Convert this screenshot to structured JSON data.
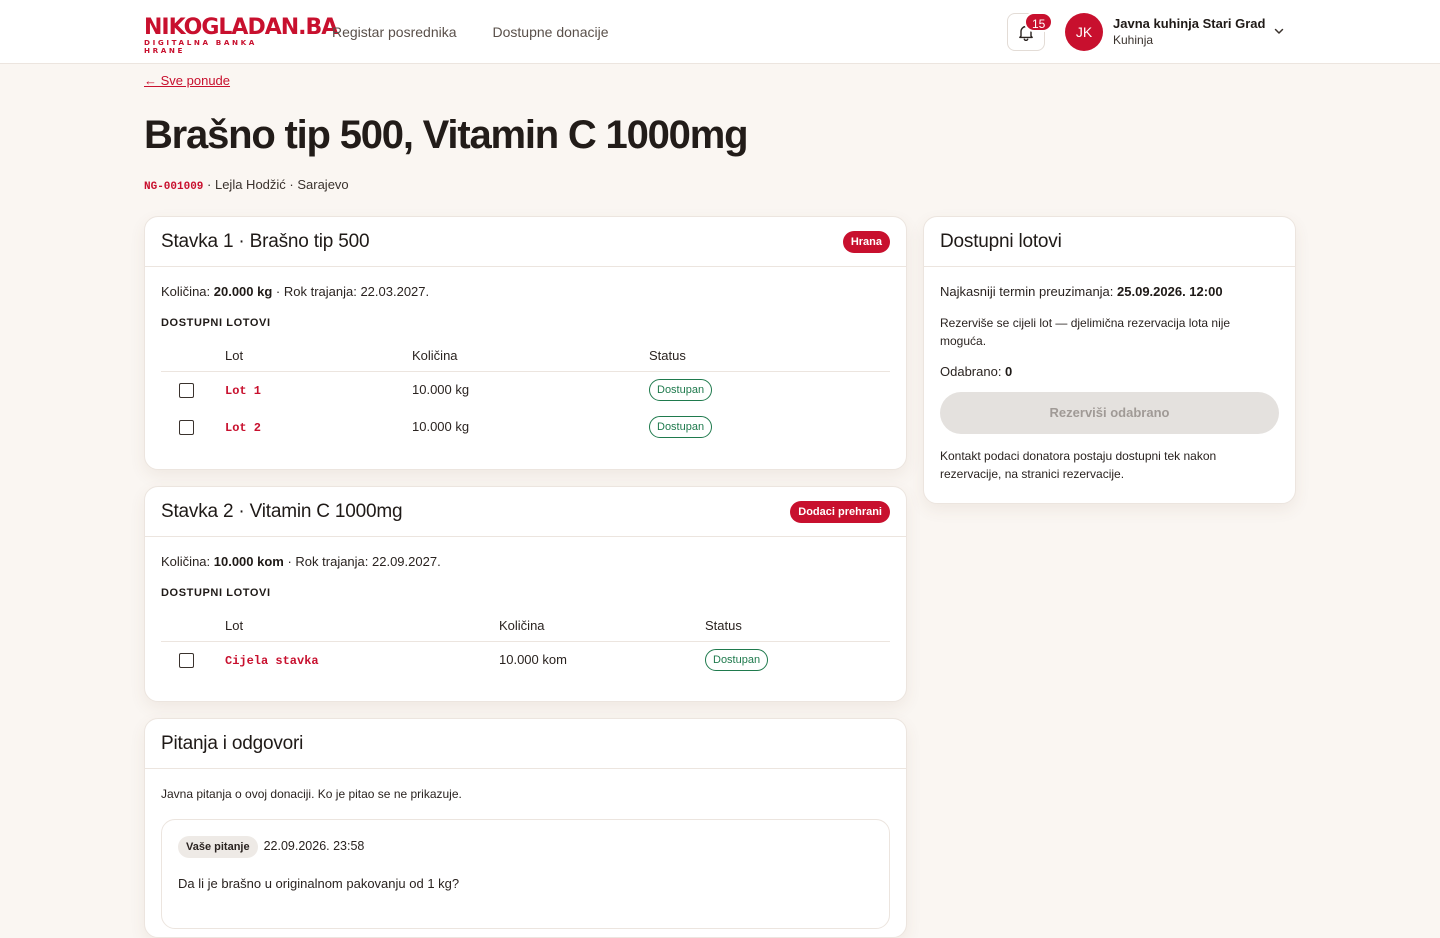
{
  "brand": {
    "name": "NIKOGLADAN.BA",
    "tagline": "DIGITALNA BANKA HRANE"
  },
  "nav": [
    {
      "label": "Registar posrednika"
    },
    {
      "label": "Dostupne donacije"
    }
  ],
  "notifications": {
    "count": "15"
  },
  "user": {
    "initials": "JK",
    "name": "Javna kuhinja Stari Grad",
    "role": "Kuhinja"
  },
  "page": {
    "back_label": "← Sve ponude",
    "title": "Brašno tip 500, Vitamin C 1000mg",
    "code": "NG-001009",
    "meta_rest": " · Lejla Hodžić · Sarajevo"
  },
  "items": [
    {
      "title": "Stavka 1 · Brašno tip 500",
      "category": "Hrana",
      "qty_label": "Količina: ",
      "qty_value": "20.000 kg",
      "expiry": " · Rok trajanja: 22.03.2027.",
      "section_label": "DOSTUPNI LOTOVI",
      "columns": [
        "Lot",
        "Količina",
        "Status"
      ],
      "lots": [
        {
          "code": "Lot 1",
          "qty": "10.000 kg",
          "status": "Dostupan"
        },
        {
          "code": "Lot 2",
          "qty": "10.000 kg",
          "status": "Dostupan"
        }
      ]
    },
    {
      "title": "Stavka 2 · Vitamin C 1000mg",
      "category": "Dodaci prehrani",
      "qty_label": "Količina: ",
      "qty_value": "10.000 kom",
      "expiry": " · Rok trajanja: 22.09.2027.",
      "section_label": "DOSTUPNI LOTOVI",
      "columns": [
        "Lot",
        "Količina",
        "Status"
      ],
      "lots": [
        {
          "code": "Cijela stavka",
          "qty": "10.000 kom",
          "status": "Dostupan"
        }
      ]
    }
  ],
  "side": {
    "title": "Dostupni lotovi",
    "deadline_label": "Najkasniji termin preuzimanja: ",
    "deadline_value": "25.09.2026. 12:00",
    "note": "Rezerviše se cijeli lot — djelimična rezervacija lota nije moguća.",
    "selected_label": "Odabrano: ",
    "selected_value": "0",
    "reserve_button": "Rezerviši odabrano",
    "contact_note": "Kontakt podaci donatora postaju dostupni tek nakon rezervacije, na stranici rezervacije."
  },
  "qa": {
    "title": "Pitanja i odgovori",
    "intro": "Javna pitanja o ovoj donaciji. Ko je pitao se ne prikazuje.",
    "questions": [
      {
        "tag": "Vaše pitanje",
        "time": "22.09.2026. 23:58",
        "text": "Da li je brašno u originalnom pakovanju od 1 kg?"
      }
    ]
  },
  "colors": {
    "brand": "#c8102e",
    "background": "#faf6f2",
    "status_green": "#1f7a4d"
  }
}
